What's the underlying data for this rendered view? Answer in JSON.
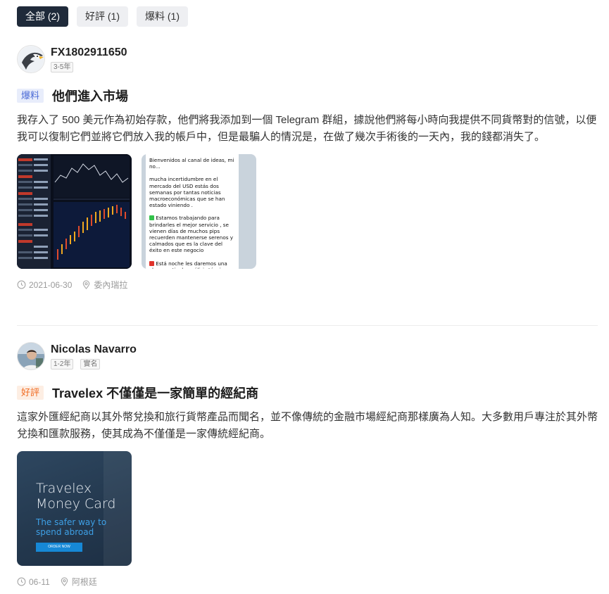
{
  "tabs": [
    {
      "label": "全部 (2)",
      "active": true
    },
    {
      "label": "好評 (1)",
      "active": false
    },
    {
      "label": "爆料 (1)",
      "active": false
    }
  ],
  "reviews": [
    {
      "user": {
        "name": "FX1802911650",
        "badges": [
          "3-5年"
        ],
        "avatar_icon": "eagle-avatar"
      },
      "tag": "爆料",
      "title": "他們進入市場",
      "body": "我存入了 500 美元作為初始存款，他們將我添加到一個 Telegram 群組，據說他們將每小時向我提供不同貨幣對的信號，以便我可以復制它們並將它們放入我的帳戶中，但是最騙人的情況是，在做了幾次手術後的一天內，我的錢都消失了。",
      "images": [
        {
          "kind": "trading-chart-screenshot"
        },
        {
          "kind": "chat-screenshot",
          "lines": [
            "Bienvenidos al canal de ideas, mi no...",
            "mucha incertidumbre en el mercado del USD estás dos semanas por tantas noticias macroeconómicas que se han estado viniendo .",
            "Estamos trabajando para brindarles el mejor servicio , se vienen días de muchos pips recuerden mantenerse serenos y calmados que es la clave del éxito en este negocio",
            "Está noche les daremos una clase gratis de análisis técnico y trading institucional"
          ]
        }
      ],
      "date": "2021-06-30",
      "location": "委內瑞拉"
    },
    {
      "user": {
        "name": "Nicolas Navarro",
        "badges": [
          "1-2年",
          "實名"
        ],
        "avatar_icon": "user-photo-avatar"
      },
      "tag": "好評",
      "title": "Travelex 不僅僅是一家簡單的經紀商",
      "body": "這家外匯經紀商以其外幣兌換和旅行貨幣產品而聞名，並不像傳統的金融市場經紀商那樣廣為人知。大多數用戶專注於其外幣兌換和匯款服務，使其成為不僅僅是一家傳統經紀商。",
      "images": [
        {
          "kind": "travelex-card-image",
          "heading": "Travelex Money Card",
          "subheading": "The safer way to spend abroad",
          "button": "ORDER NOW"
        }
      ],
      "date": "06-11",
      "location": "阿根廷"
    }
  ],
  "colors": {
    "tab_active_bg": "#1f2a3a",
    "tag_expose": "#4b6bd6",
    "tag_praise": "#f06a20"
  },
  "icons": {
    "clock": "clock-icon",
    "location": "location-pin-icon"
  }
}
